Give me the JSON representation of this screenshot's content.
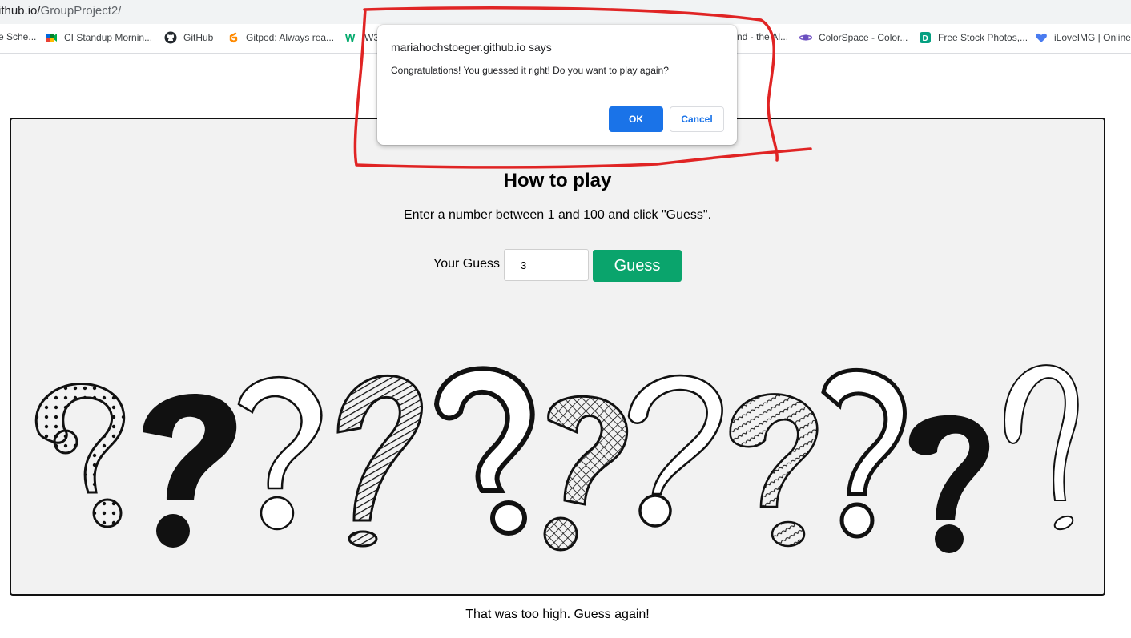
{
  "browser": {
    "url_host": "ithub.io/",
    "url_path": "GroupProject2/",
    "bookmarks": [
      {
        "label": "e Sche...",
        "icon": "calendar-icon"
      },
      {
        "label": "CI Standup Mornin...",
        "icon": "meet-icon"
      },
      {
        "label": "GitHub",
        "icon": "github-icon"
      },
      {
        "label": "Gitpod: Always rea...",
        "icon": "gitpod-icon"
      },
      {
        "label": "W3",
        "icon": "w3-icon"
      },
      {
        "label": "nd - the Al...",
        "icon": "none"
      },
      {
        "label": "ColorSpace - Color...",
        "icon": "colorspace-icon"
      },
      {
        "label": "Free Stock Photos,...",
        "icon": "stock-photos-icon"
      },
      {
        "label": "iLoveIMG | Online-...",
        "icon": "ilovemg-icon"
      }
    ]
  },
  "game": {
    "heading": "How to play",
    "instructions": "Enter a number between 1 and 100 and click \"Guess\".",
    "guess_label": "Your Guess",
    "guess_value": "3",
    "guess_button": "Guess",
    "feedback": "That was too high. Guess again!",
    "accent_color": "#0aa46c"
  },
  "dialog": {
    "title": "mariahochstoeger.github.io says",
    "message": "Congratulations! You guessed it right! Do you want to play again?",
    "ok_label": "OK",
    "cancel_label": "Cancel"
  },
  "colors": {
    "ok_button": "#1a73e8",
    "annotation": "#e02424"
  }
}
